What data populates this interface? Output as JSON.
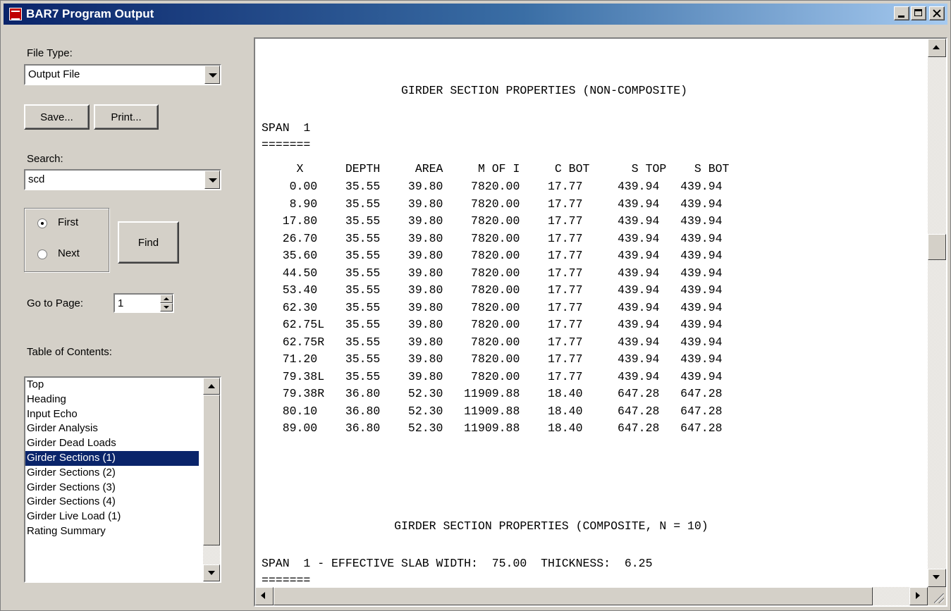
{
  "window": {
    "title": "BAR7 Program Output"
  },
  "left_panel": {
    "file_type_label": "File Type:",
    "file_type_value": "Output File",
    "save_label": "Save...",
    "print_label": "Print...",
    "search_label": "Search:",
    "search_value": "scd",
    "radio_first_label": "First",
    "radio_next_label": "Next",
    "radio_selected": "First",
    "find_label": "Find",
    "goto_page_label": "Go to Page:",
    "goto_page_value": "1",
    "toc_label": "Table of Contents:",
    "toc_items": [
      "Top",
      "Heading",
      "Input Echo",
      "Girder Analysis",
      "Girder Dead Loads",
      "Girder Sections (1)",
      "Girder Sections (2)",
      "Girder Sections (3)",
      "Girder Sections (4)",
      "Girder Live Load (1)",
      "Rating Summary"
    ],
    "toc_selected": "Girder Sections (1)"
  },
  "output": {
    "lines": [
      "",
      "",
      "                    GIRDER SECTION PROPERTIES (NON-COMPOSITE)",
      "",
      "SPAN  1",
      "=======",
      "     X      DEPTH     AREA     M OF I     C BOT      S TOP    S BOT",
      "    0.00    35.55    39.80    7820.00    17.77     439.94   439.94",
      "    8.90    35.55    39.80    7820.00    17.77     439.94   439.94",
      "   17.80    35.55    39.80    7820.00    17.77     439.94   439.94",
      "   26.70    35.55    39.80    7820.00    17.77     439.94   439.94",
      "   35.60    35.55    39.80    7820.00    17.77     439.94   439.94",
      "   44.50    35.55    39.80    7820.00    17.77     439.94   439.94",
      "   53.40    35.55    39.80    7820.00    17.77     439.94   439.94",
      "   62.30    35.55    39.80    7820.00    17.77     439.94   439.94",
      "   62.75L   35.55    39.80    7820.00    17.77     439.94   439.94",
      "   62.75R   35.55    39.80    7820.00    17.77     439.94   439.94",
      "   71.20    35.55    39.80    7820.00    17.77     439.94   439.94",
      "   79.38L   35.55    39.80    7820.00    17.77     439.94   439.94",
      "   79.38R   36.80    52.30   11909.88    18.40     647.28   647.28",
      "   80.10    36.80    52.30   11909.88    18.40     647.28   647.28",
      "   89.00    36.80    52.30   11909.88    18.40     647.28   647.28",
      "",
      "",
      "",
      "                   GIRDER SECTION PROPERTIES (COMPOSITE, N = 10)",
      "",
      "SPAN  1 - EFFECTIVE SLAB WIDTH:  75.00  THICKNESS:  6.25",
      "======="
    ]
  }
}
